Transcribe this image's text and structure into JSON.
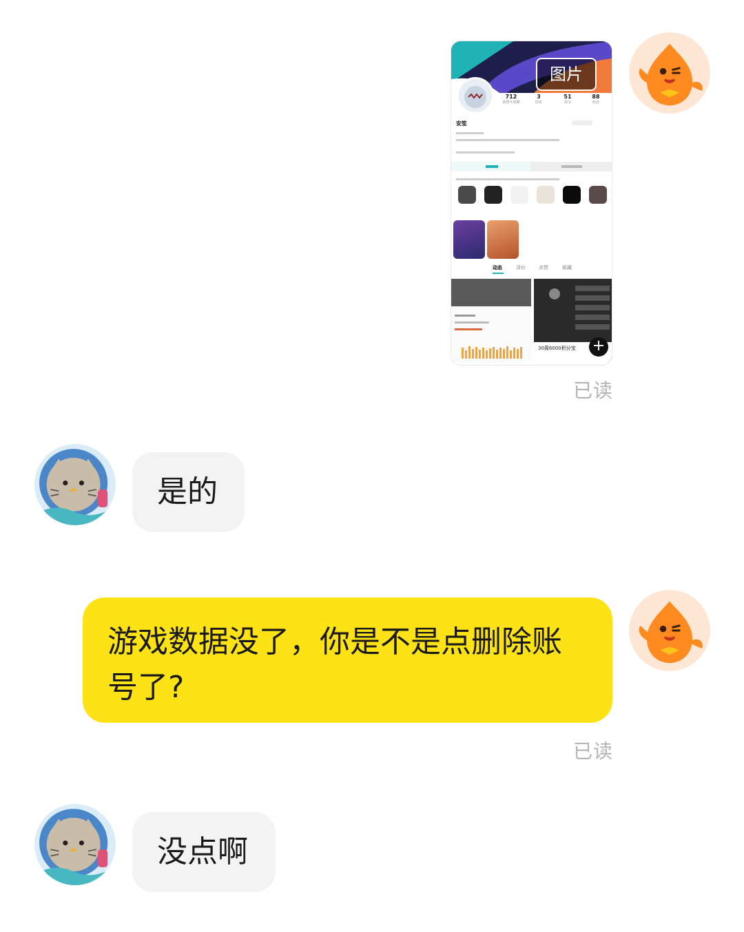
{
  "messages": {
    "image_message": {
      "tag_label": "图片",
      "read_status": "已读",
      "screenshot": {
        "stats": [
          {
            "value": "712"
          },
          {
            "value": "3"
          },
          {
            "value": "51"
          },
          {
            "value": "88"
          }
        ],
        "username": "安笙",
        "feed_tabs": [
          "动态",
          "评价",
          "点赞",
          "收藏"
        ],
        "caption": "30周6000积分宝"
      }
    },
    "reply_1": {
      "text": "是的"
    },
    "outgoing_2": {
      "text": "游戏数据没了，你是不是点删除账号了?",
      "read_status": "已读"
    },
    "reply_2": {
      "text": "没点啊"
    }
  },
  "colors": {
    "outgoing_bubble": "#fde215",
    "incoming_bubble": "#f3f3f3",
    "read_text": "#b3b3b3"
  },
  "icons": {
    "self_avatar": "orange-mascot-avatar-icon",
    "other_avatar": "cat-astronaut-avatar-icon"
  }
}
